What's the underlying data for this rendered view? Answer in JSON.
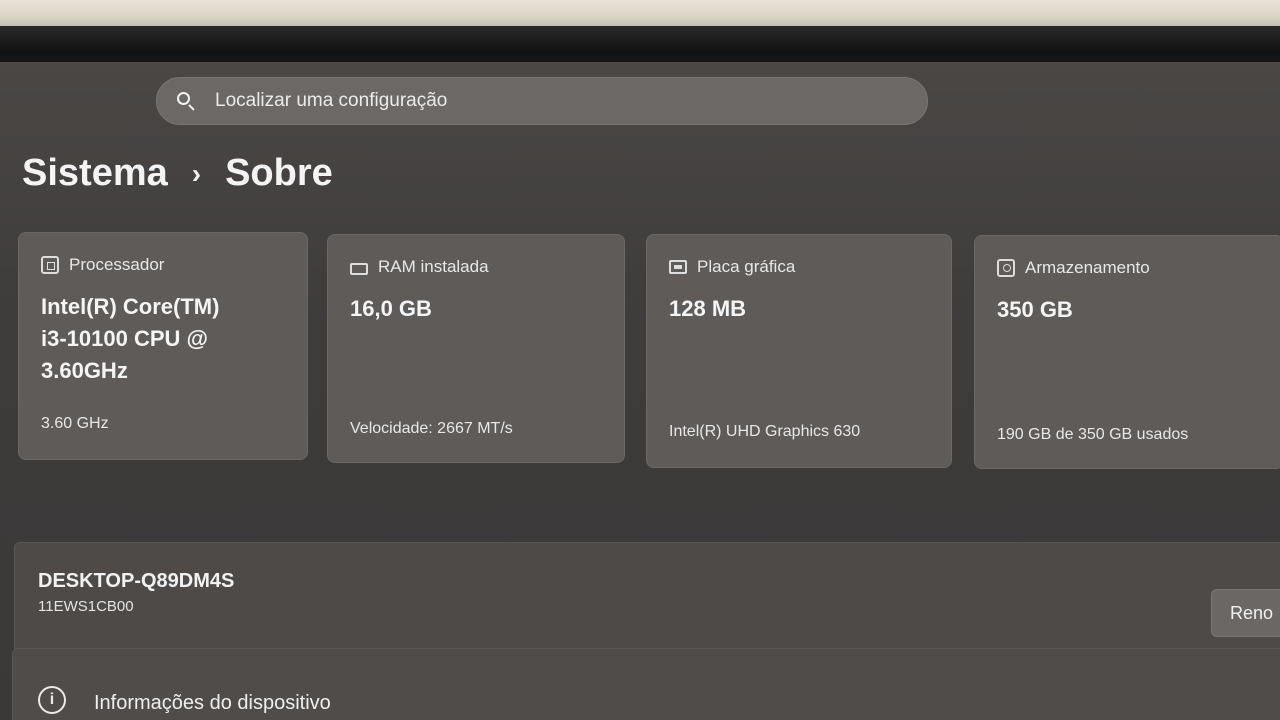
{
  "search": {
    "placeholder": "Localizar uma configuração"
  },
  "breadcrumb": {
    "parent": "Sistema",
    "separator": "›",
    "current": "Sobre"
  },
  "specs": {
    "processor": {
      "label": "Processador",
      "value": "Intel(R) Core(TM) i3-10100 CPU @ 3.60GHz",
      "detail": "3.60 GHz"
    },
    "ram": {
      "label": "RAM instalada",
      "value": "16,0 GB",
      "detail": "Velocidade: 2667 MT/s"
    },
    "gpu": {
      "label": "Placa gráfica",
      "value": "128 MB",
      "detail": "Intel(R) UHD Graphics 630"
    },
    "storage": {
      "label": "Armazenamento",
      "value": "350 GB",
      "detail": "190 GB de 350 GB usados"
    }
  },
  "device": {
    "name": "DESKTOP-Q89DM4S",
    "model": "11EWS1CB00",
    "rename_label": "Reno"
  },
  "device_info": {
    "icon": "info-icon",
    "icon_glyph": "i",
    "label": "Informações do dispositivo"
  }
}
